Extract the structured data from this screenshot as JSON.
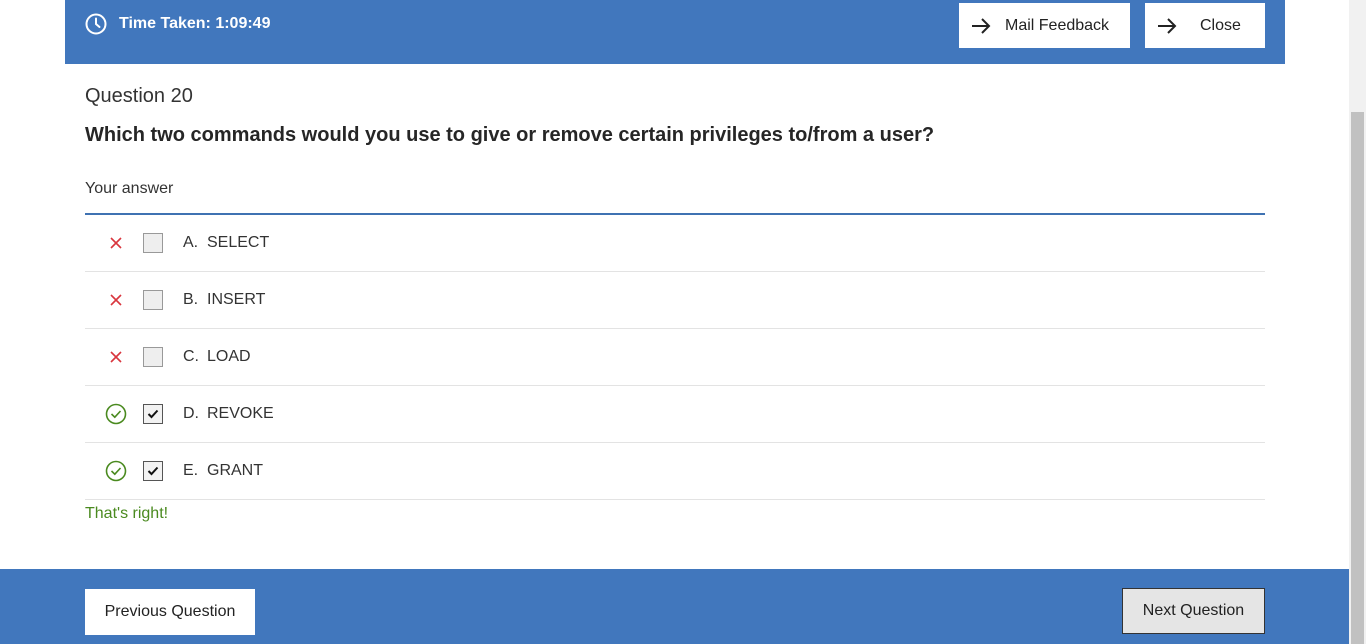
{
  "header": {
    "timer_text": "Time Taken: 1:09:49",
    "timer_icon": "clock-icon",
    "mail_feedback_label": "Mail Feedback",
    "close_label": "Close",
    "button_icon": "arrow-right-icon"
  },
  "question": {
    "number_label": "Question 20",
    "text": "Which two commands would you use to give or remove certain privileges to/from a user?",
    "your_answer_label": "Your answer",
    "options": [
      {
        "letter": "A.",
        "text": "SELECT",
        "checked": false,
        "status": "incorrect"
      },
      {
        "letter": "B.",
        "text": "INSERT",
        "checked": false,
        "status": "incorrect"
      },
      {
        "letter": "C.",
        "text": "LOAD",
        "checked": false,
        "status": "incorrect"
      },
      {
        "letter": "D.",
        "text": "REVOKE",
        "checked": true,
        "status": "correct"
      },
      {
        "letter": "E.",
        "text": "GRANT",
        "checked": true,
        "status": "correct"
      }
    ],
    "feedback": "That's right!"
  },
  "footer": {
    "previous_label": "Previous Question",
    "next_label": "Next Question"
  },
  "colors": {
    "brand_blue": "#4177bd",
    "correct_green": "#4a8a1f",
    "incorrect_red": "#d9363e"
  }
}
